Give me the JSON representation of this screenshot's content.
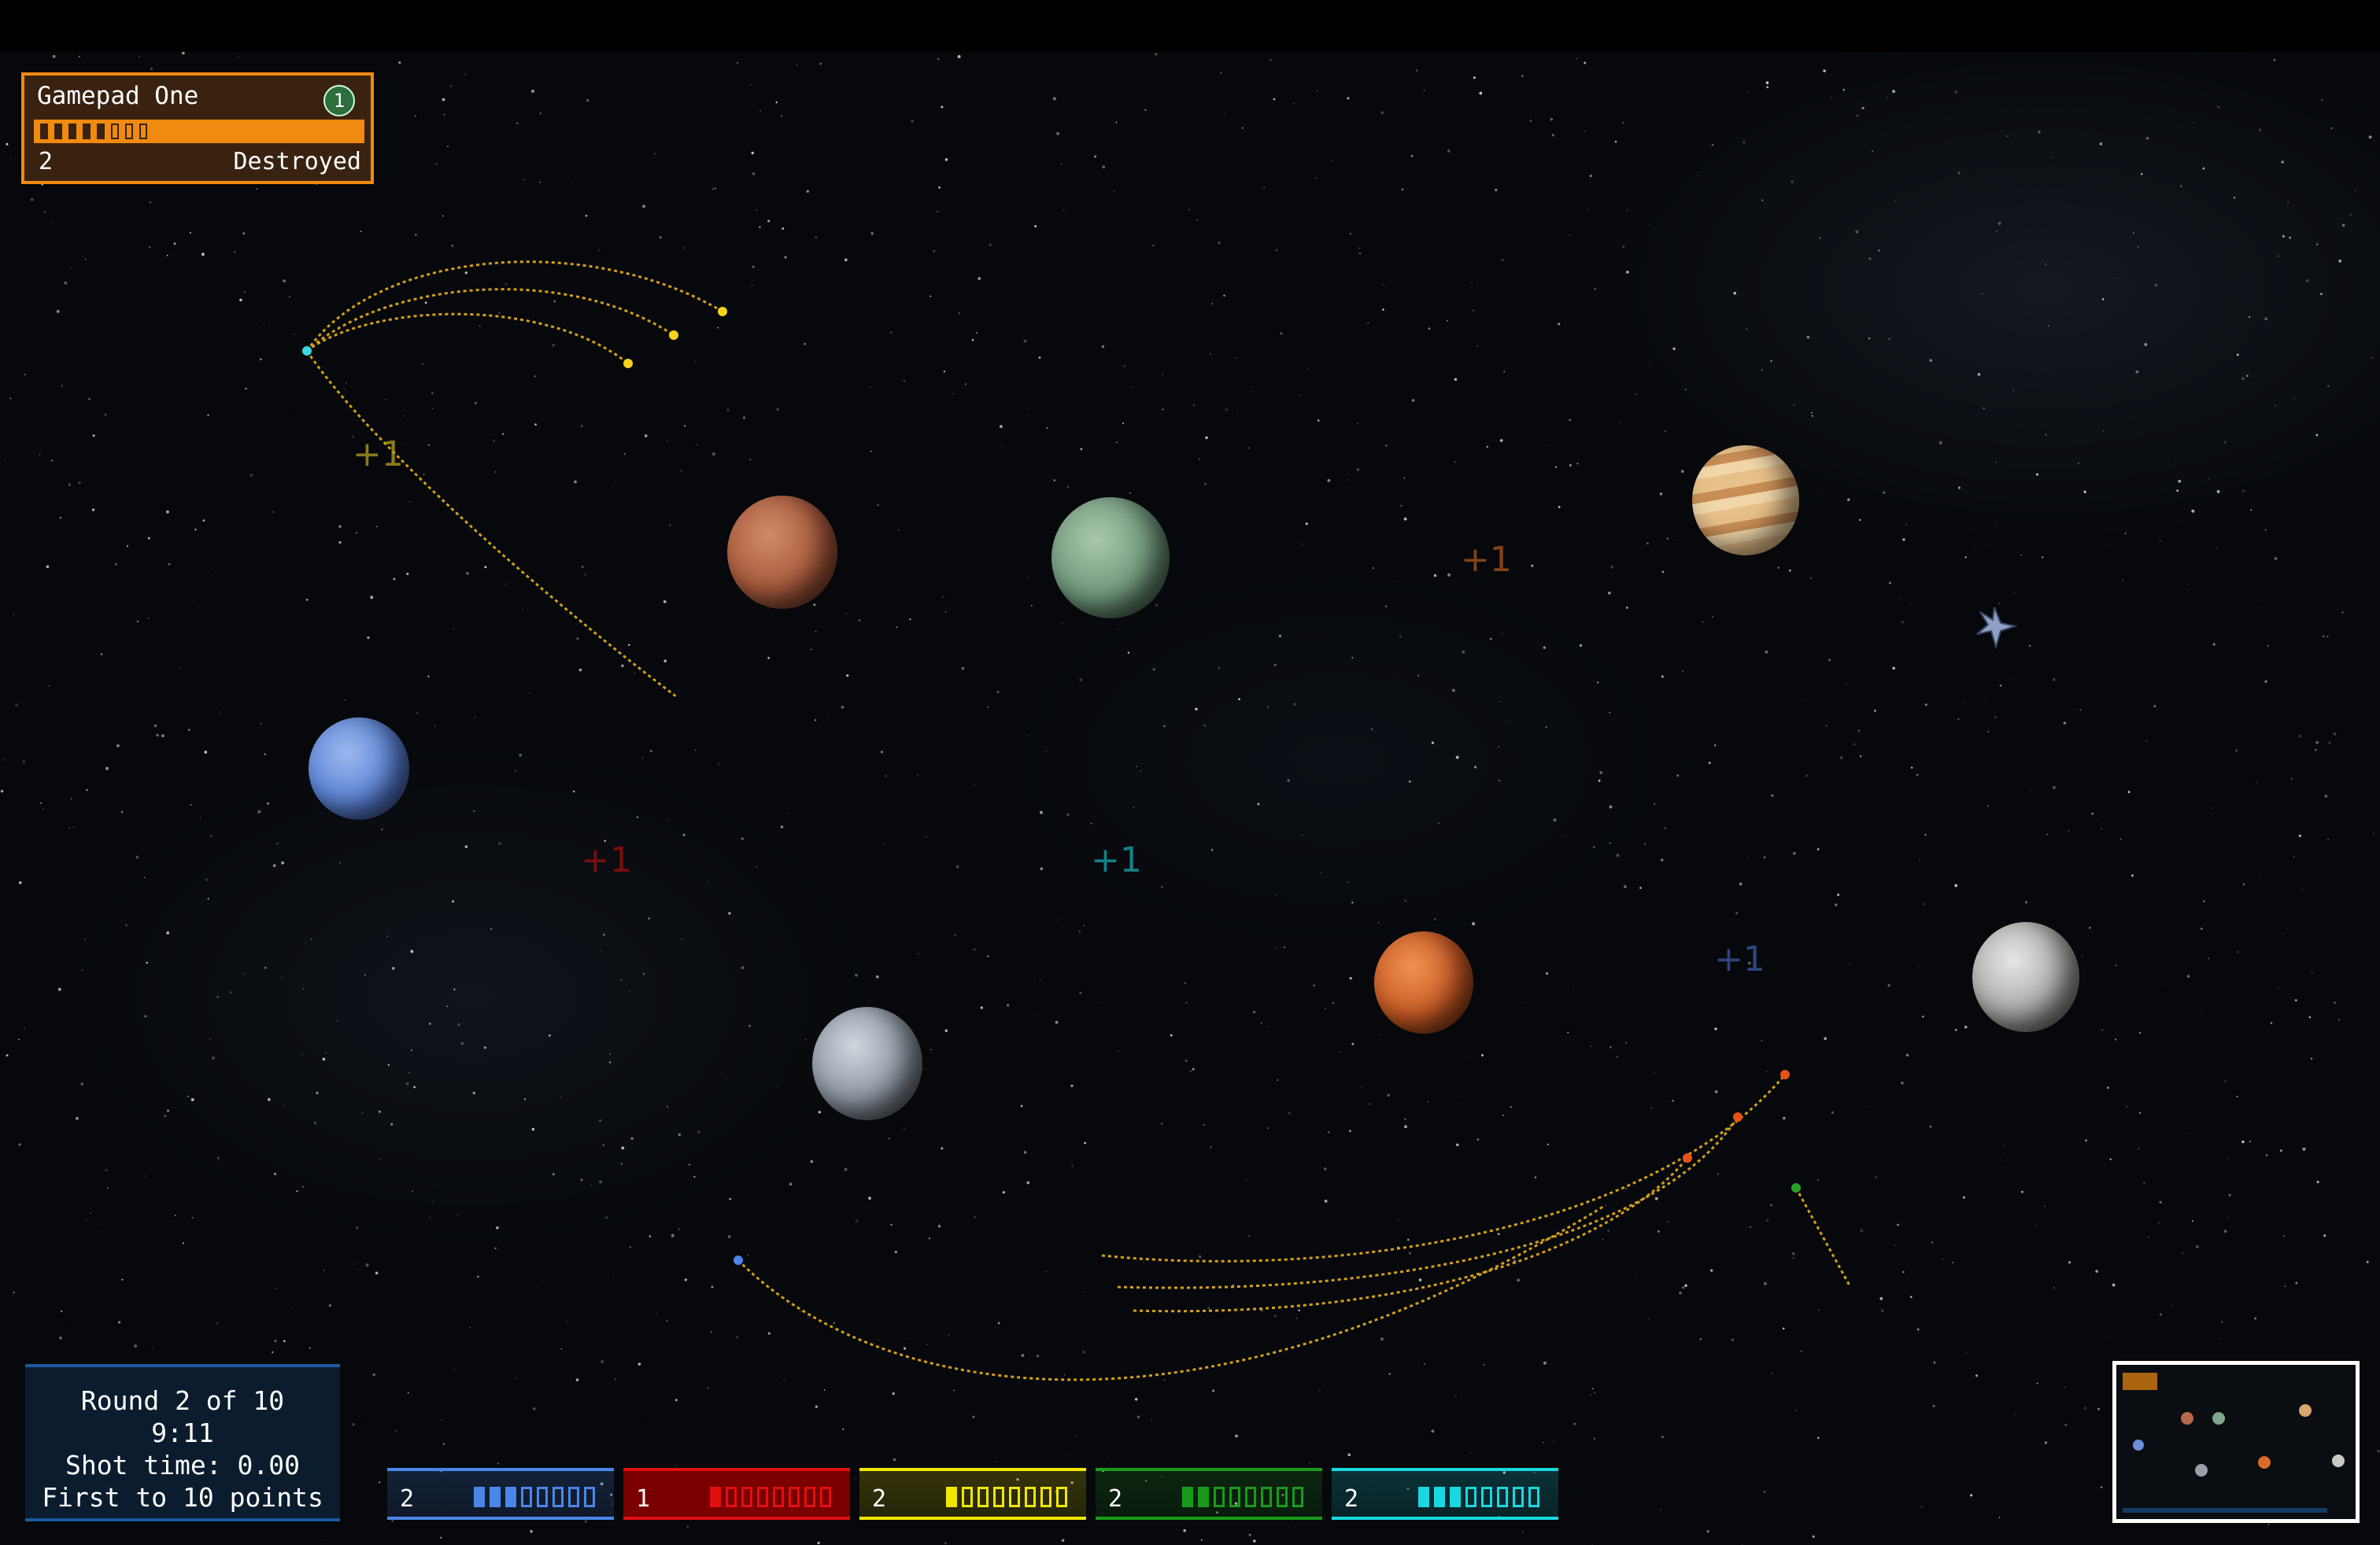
{
  "player_panel": {
    "name": "Gamepad One",
    "badge": "1",
    "score": "2",
    "status": "Destroyed",
    "accent_color": "#f08a10",
    "power_level_fraction": 0.45
  },
  "round_info": {
    "round": "Round 2 of 10",
    "timer": "9:11",
    "shot_time": "Shot time: 0.00",
    "goal": "First to 10 points"
  },
  "players": [
    {
      "score": "2",
      "color": "#4a86e8",
      "filled": 3,
      "total": 8
    },
    {
      "score": "1",
      "color": "#e01010",
      "filled": 1,
      "total": 8
    },
    {
      "score": "2",
      "color": "#f2e600",
      "filled": 1,
      "total": 8
    },
    {
      "score": "2",
      "color": "#1a9a1a",
      "filled": 2,
      "total": 8
    },
    {
      "score": "2",
      "color": "#18d8e0",
      "filled": 3,
      "total": 8
    }
  ],
  "score_popups": [
    {
      "text": "+1",
      "color": "#b8a020"
    },
    {
      "text": "+1",
      "color": "#b0561a"
    },
    {
      "text": "+1",
      "color": "#a01010"
    },
    {
      "text": "+1",
      "color": "#18a8b0"
    },
    {
      "text": "+1",
      "color": "#3a5aa8"
    }
  ],
  "planets": [
    {
      "name": "mars-like",
      "color": "#b86a48"
    },
    {
      "name": "green",
      "color": "#7fa58a"
    },
    {
      "name": "jupiter-like",
      "color": "#d8a66e"
    },
    {
      "name": "neptune-like",
      "color": "#6a8ed8"
    },
    {
      "name": "orange",
      "color": "#d86a2a"
    },
    {
      "name": "gray-moon",
      "color": "#9aa0a8"
    },
    {
      "name": "white-moon",
      "color": "#c8c8c8"
    }
  ]
}
